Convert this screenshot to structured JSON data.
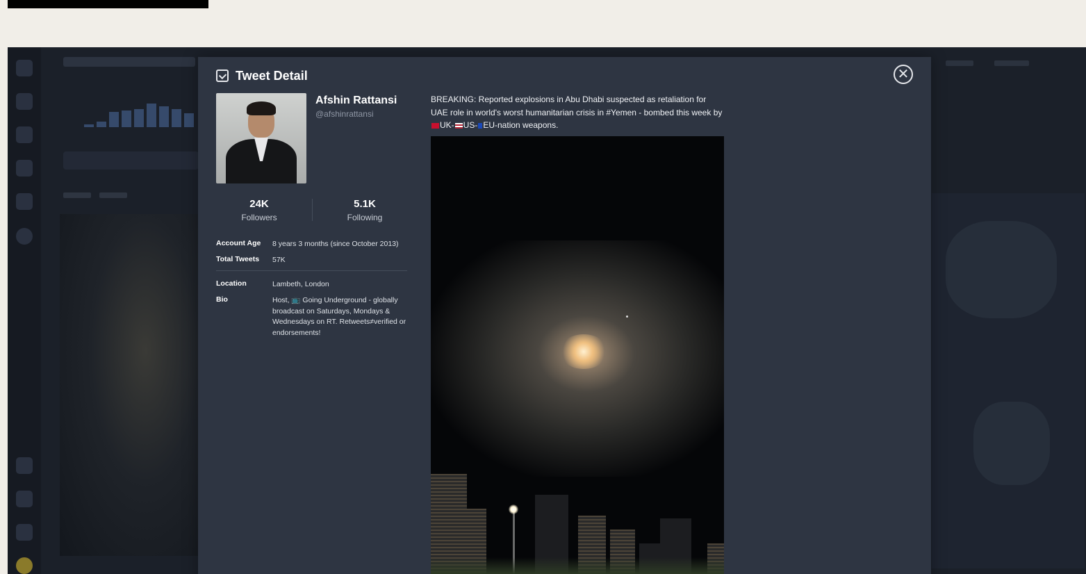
{
  "modal": {
    "title": "Tweet Detail",
    "title_icon": "tweet-detail-icon",
    "close_icon": "close-icon",
    "close_symbol": "✕"
  },
  "profile": {
    "name": "Afshin Rattansi",
    "handle": "@afshinrattansi",
    "followers_count": "24K",
    "followers_label": "Followers",
    "following_count": "5.1K",
    "following_label": "Following",
    "account_age_label": "Account Age",
    "account_age_value": "8 years  3 months (since October 2013)",
    "total_tweets_label": "Total Tweets",
    "total_tweets_value": "57K",
    "location_label": "Location",
    "location_value": "Lambeth, London",
    "bio_label": "Bio",
    "bio_value": "Host, 📺 Going Underground - globally broadcast on Saturdays, Mondays & Wednesdays on RT. Retweets≠verified or endorsements!"
  },
  "tweet": {
    "text_part1": "BREAKING: Reported explosions in Abu Dhabi suspected as retaliation for UAE role in world's worst humanitarian crisis in #Yemen - bombed this week by ",
    "text_uk": "UK-",
    "text_us": "US-",
    "text_eu": "EU-nation weapons.",
    "media_type": "video-still"
  },
  "colors": {
    "page_bg": "#f1eee8",
    "app_bg": "#1b2029",
    "modal_bg": "#2e3542",
    "text_primary": "#ffffff",
    "text_muted": "#8f97a5"
  }
}
